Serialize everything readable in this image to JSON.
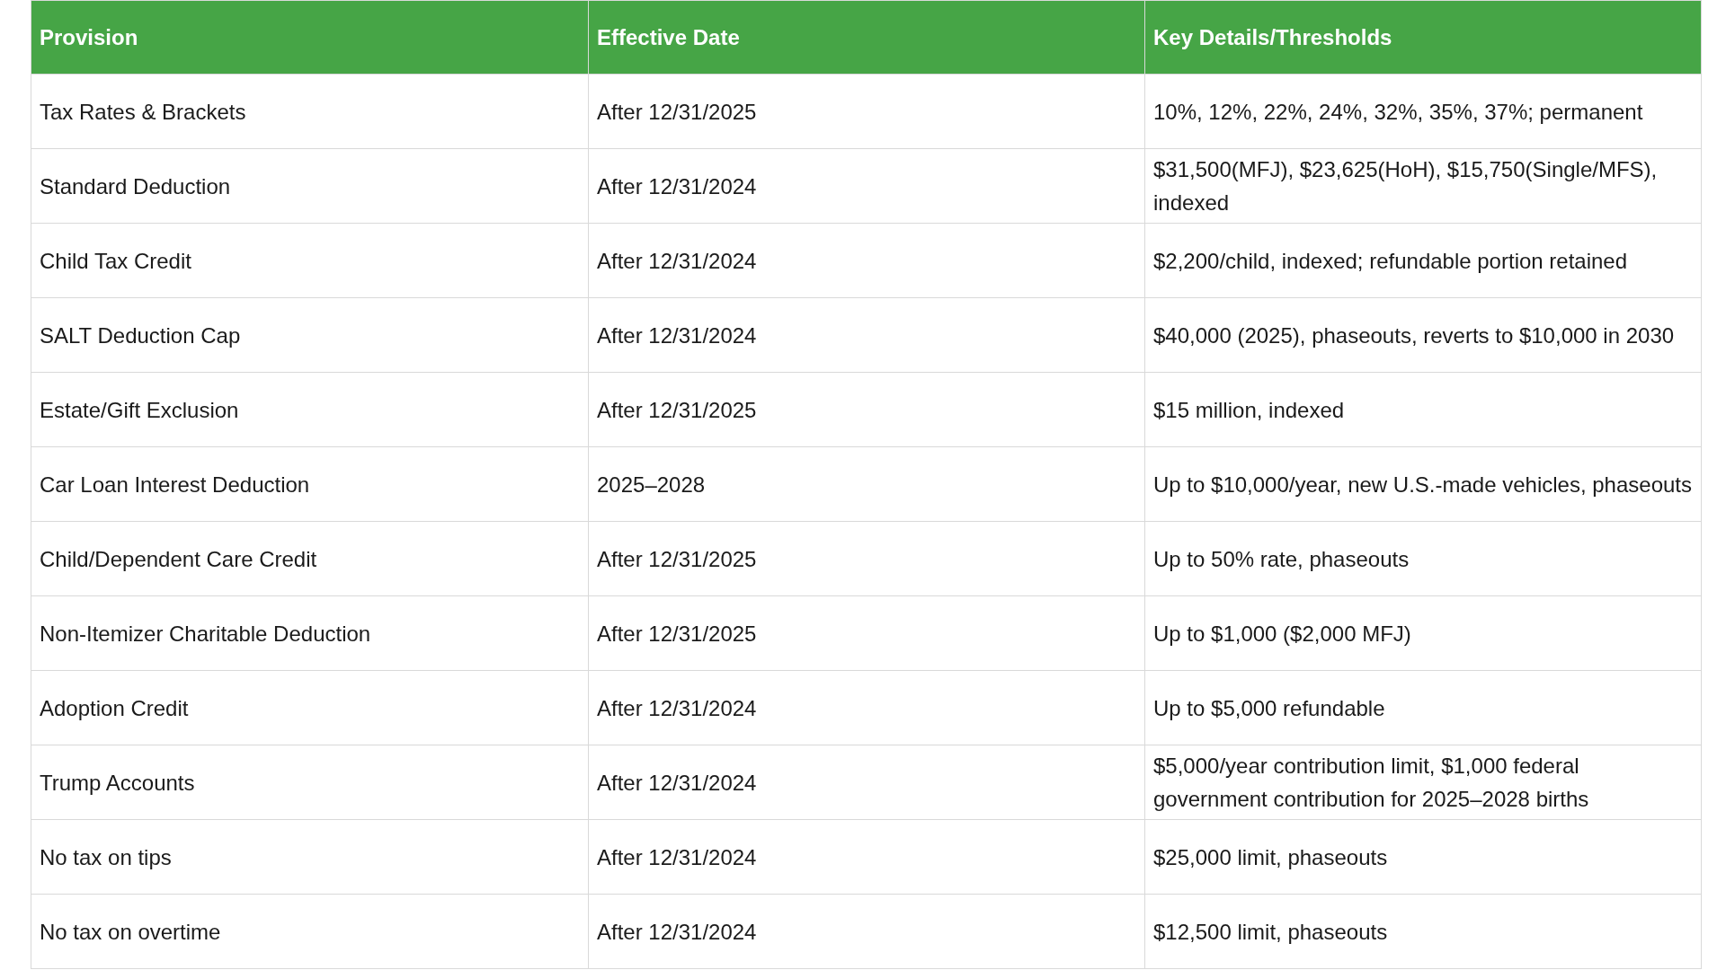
{
  "table": {
    "columns": [
      "Provision",
      "Effective Date",
      "Key Details/Thresholds"
    ],
    "rows": [
      [
        "Tax Rates & Brackets",
        "After 12/31/2025",
        "10%, 12%, 22%, 24%, 32%, 35%, 37%; permanent"
      ],
      [
        "Standard Deduction",
        "After 12/31/2024",
        "$31,500(MFJ), $23,625(HoH), $15,750(Single/MFS), indexed"
      ],
      [
        "Child Tax Credit",
        "After 12/31/2024",
        "$2,200/child, indexed; refundable portion retained"
      ],
      [
        "SALT Deduction Cap",
        "After 12/31/2024",
        "$40,000 (2025), phaseouts, reverts to $10,000 in 2030"
      ],
      [
        "Estate/Gift Exclusion",
        "After 12/31/2025",
        "$15 million, indexed"
      ],
      [
        "Car Loan Interest Deduction",
        "2025–2028",
        "Up to $10,000/year, new U.S.-made vehicles, phaseouts"
      ],
      [
        "Child/Dependent Care Credit",
        "After 12/31/2025",
        "Up to 50% rate, phaseouts"
      ],
      [
        "Non-Itemizer Charitable Deduction",
        "After 12/31/2025",
        "Up to $1,000 ($2,000 MFJ)"
      ],
      [
        "Adoption Credit",
        "After 12/31/2024",
        "Up to $5,000 refundable"
      ],
      [
        "Trump Accounts",
        "After 12/31/2024",
        "$5,000/year contribution limit, $1,000 federal government contribution for 2025–2028 births"
      ],
      [
        "No tax on tips",
        "After 12/31/2024",
        "$25,000 limit, phaseouts"
      ],
      [
        "No tax on overtime",
        "After 12/31/2024",
        "$12,500 limit, phaseouts"
      ]
    ]
  }
}
